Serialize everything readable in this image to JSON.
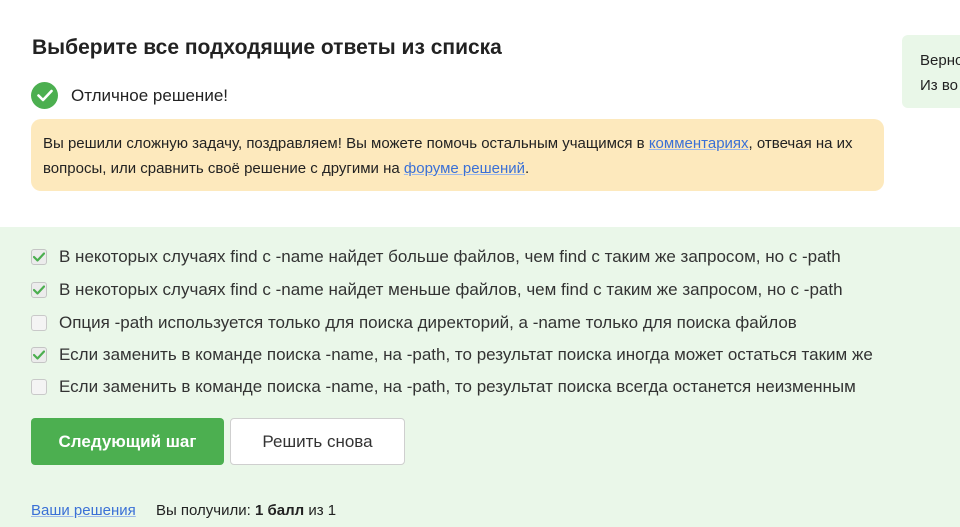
{
  "quiz": {
    "title": "Выберите все подходящие ответы из списка",
    "status_text": "Отличное решение!",
    "notice": {
      "text_before": "Вы решили сложную задачу, поздравляем! Вы можете помочь остальным учащимся в ",
      "link1": "комментариях",
      "text_middle": ", отвечая на их вопросы, или сравнить своё решение с другими на ",
      "link2": "форуме решений",
      "text_after": "."
    },
    "hint": {
      "line1": "Верно",
      "line2": "Из во"
    },
    "options": [
      {
        "label": "В некоторых случаях find с -name найдет больше файлов, чем find с таким же запросом, но с -path",
        "checked": true
      },
      {
        "label": "В некоторых случаях find с -name найдет меньше файлов, чем find с таким же запросом, но с -path",
        "checked": true
      },
      {
        "label": "Опция -path используется только для поиска директорий, а -name только для поиска файлов",
        "checked": false
      },
      {
        "label": "Если заменить в команде поиска -name, на -path, то результат поиска иногда может остаться таким же",
        "checked": true
      },
      {
        "label": "Если заменить в команде поиска -name, на -path, то результат поиска всегда останется неизменным",
        "checked": false
      }
    ],
    "buttons": {
      "next": "Следующий шаг",
      "retry": "Решить снова"
    },
    "footer": {
      "solutions_link": "Ваши решения",
      "received_label": "Вы получили:",
      "score": "1 балл",
      "of_label": "из",
      "max": "1"
    }
  },
  "colors": {
    "success": "#4caf50",
    "notice_bg": "#fde9bd",
    "answers_bg": "#eaf7e9",
    "link": "#3a70d6"
  }
}
